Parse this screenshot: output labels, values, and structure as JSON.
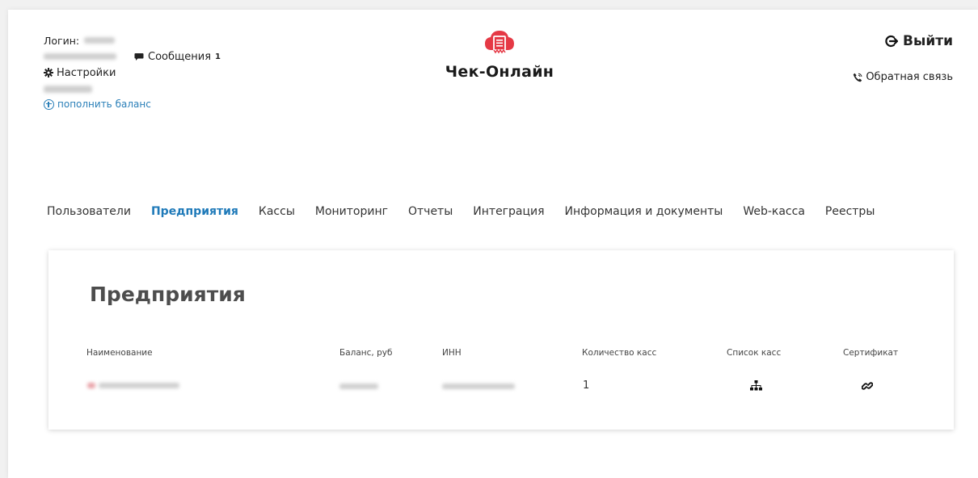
{
  "header": {
    "login_label": "Логин:",
    "messages_label": "Сообщения",
    "messages_count": "1",
    "settings_label": "Настройки",
    "topup_label": "пополнить баланс",
    "logo_title": "Чек-Онлайн",
    "logout_label": "Выйти",
    "feedback_label": "Обратная связь",
    "brand_color": "#e53945",
    "accent_color": "#1f7ab9"
  },
  "nav": {
    "items": [
      {
        "label": "Пользователи",
        "active": false
      },
      {
        "label": "Предприятия",
        "active": true
      },
      {
        "label": "Кассы",
        "active": false
      },
      {
        "label": "Мониторинг",
        "active": false
      },
      {
        "label": "Отчеты",
        "active": false
      },
      {
        "label": "Интеграция",
        "active": false
      },
      {
        "label": "Информация и документы",
        "active": false
      },
      {
        "label": "Web-касса",
        "active": false
      },
      {
        "label": "Реестры",
        "active": false
      }
    ]
  },
  "main": {
    "title": "Предприятия",
    "columns": {
      "name": "Наименование",
      "balance": "Баланс, руб",
      "inn": "ИНН",
      "kkt_count": "Количество касс",
      "kkt_list": "Список касс",
      "certificate": "Сертификат"
    },
    "rows": [
      {
        "kkt_count": "1",
        "kkt_list_icon": "sitemap-icon",
        "certificate_icon": "link-icon"
      }
    ]
  }
}
